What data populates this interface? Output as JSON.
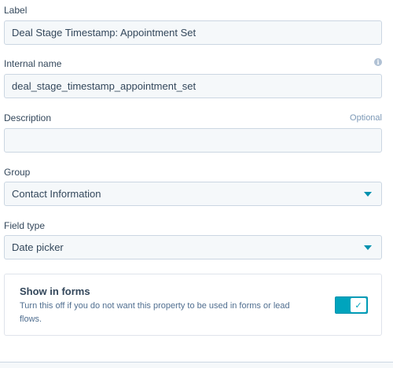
{
  "form": {
    "label": {
      "title": "Label",
      "value": "Deal Stage Timestamp: Appointment Set"
    },
    "internal_name": {
      "title": "Internal name",
      "value": "deal_stage_timestamp_appointment_set",
      "info_icon": "info-icon"
    },
    "description": {
      "title": "Description",
      "optional_text": "Optional",
      "value": ""
    },
    "group": {
      "title": "Group",
      "value": "Contact Information",
      "caret_icon": "caret-down-icon"
    },
    "field_type": {
      "title": "Field type",
      "value": "Date picker",
      "caret_icon": "caret-down-icon"
    },
    "show_in_forms": {
      "title": "Show in forms",
      "description": "Turn this off if you do not want this property to be used in forms or lead flows.",
      "toggle_on": true,
      "check_icon": "check-icon"
    }
  },
  "colors": {
    "accent": "#00a4bd",
    "caret": "#0091ae",
    "field_bg": "#f5f8fa",
    "field_border": "#cbd6e2",
    "text": "#33475b"
  }
}
